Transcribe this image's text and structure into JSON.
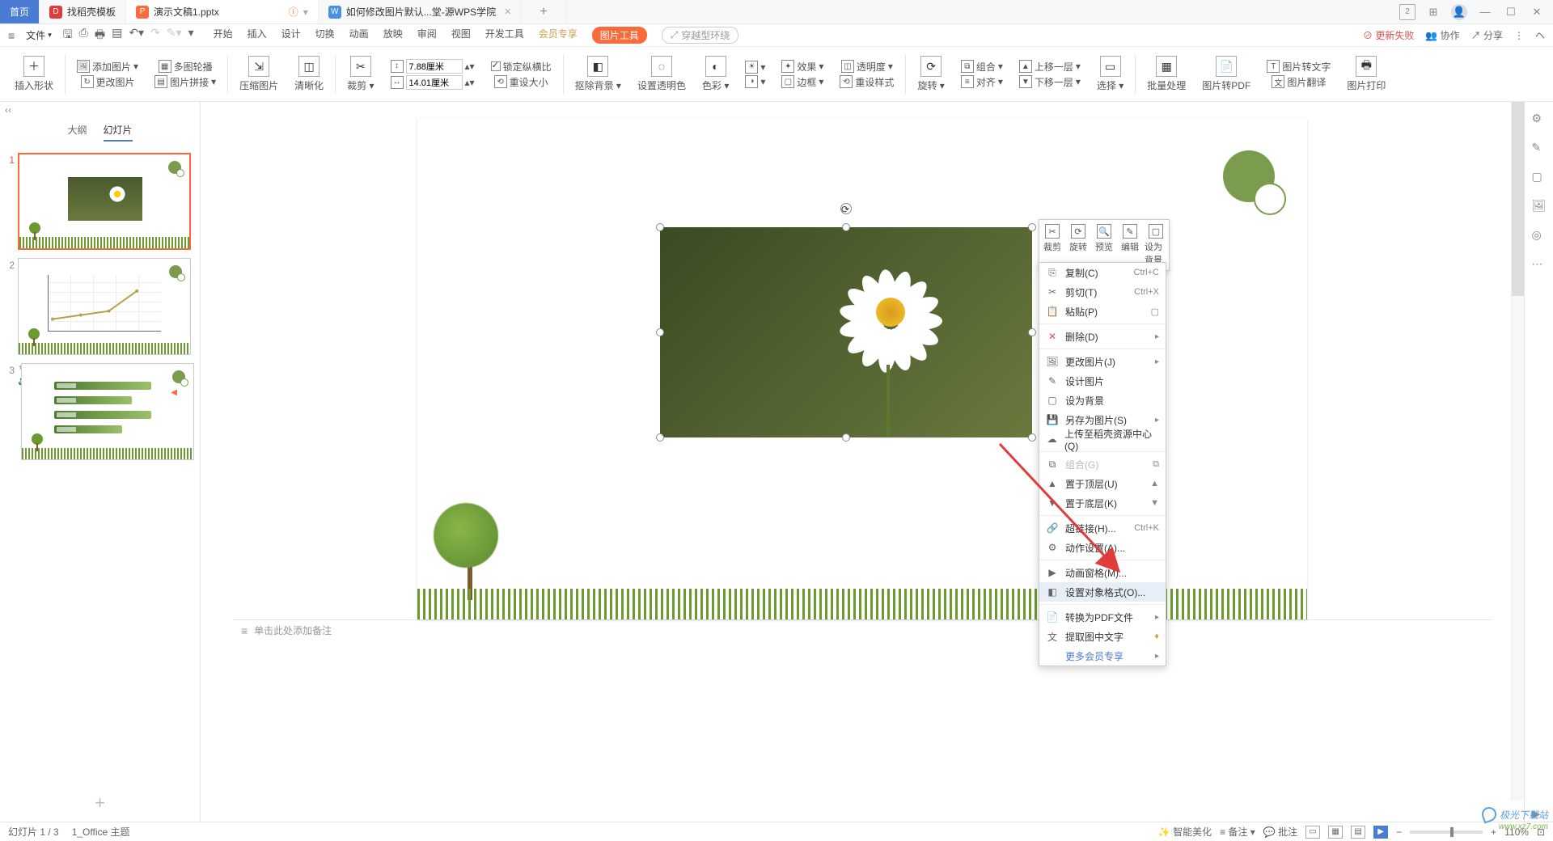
{
  "titlebar": {
    "home": "首页",
    "tabs": [
      {
        "icon_bg": "#e13c3c",
        "icon_text": "D",
        "label": "找稻壳模板"
      },
      {
        "icon_bg": "#fb6a3b",
        "icon_text": "P",
        "label": "演示文稿1.pptx",
        "active": true,
        "warn": true
      },
      {
        "icon_bg": "#4a90e2",
        "icon_text": "W",
        "label": "如何修改图片默认...堂-源WPS学院"
      }
    ],
    "right_icons": [
      "window-number-icon",
      "grid-icon",
      "user-icon",
      "minimize-icon",
      "restore-icon",
      "close-icon"
    ],
    "window_number": "2"
  },
  "menubar": {
    "file": "文件",
    "tabs": [
      "开始",
      "插入",
      "设计",
      "切换",
      "动画",
      "放映",
      "审阅",
      "视图",
      "开发工具"
    ],
    "member": "会员专享",
    "picture_tools": "图片工具",
    "env": "穿越型环绕",
    "right": {
      "warn": "更新失败",
      "coop": "协作",
      "share": "分享"
    }
  },
  "ribbon": {
    "insert_shape": "插入形状",
    "add_image": "添加图片",
    "change_image": "更改图片",
    "multi_carousel": "多图轮播",
    "image_collage": "图片拼接",
    "compress": "压缩图片",
    "sharpen": "清晰化",
    "crop": "裁剪",
    "height": "7.88厘米",
    "width": "14.01厘米",
    "lock_ratio": "锁定纵横比",
    "reset_size": "重设大小",
    "remove_bg": "抠除背景",
    "set_transparent": "设置透明色",
    "color": "色彩",
    "effect": "效果",
    "transparency": "透明度",
    "border": "边框",
    "reset_style": "重设样式",
    "rotate": "旋转",
    "combine": "组合",
    "align": "对齐",
    "bring_forward": "上移一层",
    "send_backward": "下移一层",
    "select": "选择",
    "batch": "批量处理",
    "to_pdf": "图片转PDF",
    "to_text": "图片转文字",
    "translate": "图片翻译",
    "print": "图片打印"
  },
  "left_pane": {
    "outline": "大纲",
    "slides": "幻灯片",
    "count": 3
  },
  "float_tb": {
    "crop": "裁剪",
    "rotate": "旋转",
    "preview": "预览",
    "edit": "编辑",
    "set_bg": "设为背景"
  },
  "context_menu": {
    "copy": "复制(C)",
    "copy_k": "Ctrl+C",
    "cut": "剪切(T)",
    "cut_k": "Ctrl+X",
    "paste": "粘贴(P)",
    "delete": "删除(D)",
    "change_image": "更改图片(J)",
    "design_image": "设计图片",
    "set_as_bg": "设为背景",
    "save_as_image": "另存为图片(S)",
    "upload_dock": "上传至稻壳资源中心(Q)",
    "group": "组合(G)",
    "to_top": "置于顶层(U)",
    "to_bottom": "置于底层(K)",
    "hyperlink": "超链接(H)...",
    "hyperlink_k": "Ctrl+K",
    "action": "动作设置(A)...",
    "anim_pane": "动画窗格(M)...",
    "format_object": "设置对象格式(O)...",
    "to_pdf": "转换为PDF文件",
    "extract_cn": "提取图中文字",
    "more_member": "更多会员专享"
  },
  "notes": {
    "placeholder": "单击此处添加备注"
  },
  "statusbar": {
    "slide_info": "幻灯片 1 / 3",
    "theme": "1_Office 主题",
    "beautify": "智能美化",
    "notes": "备注",
    "comments": "批注",
    "zoom": "110%"
  },
  "watermark": {
    "text": "极光下载站",
    "url": "www.xz7.com"
  }
}
